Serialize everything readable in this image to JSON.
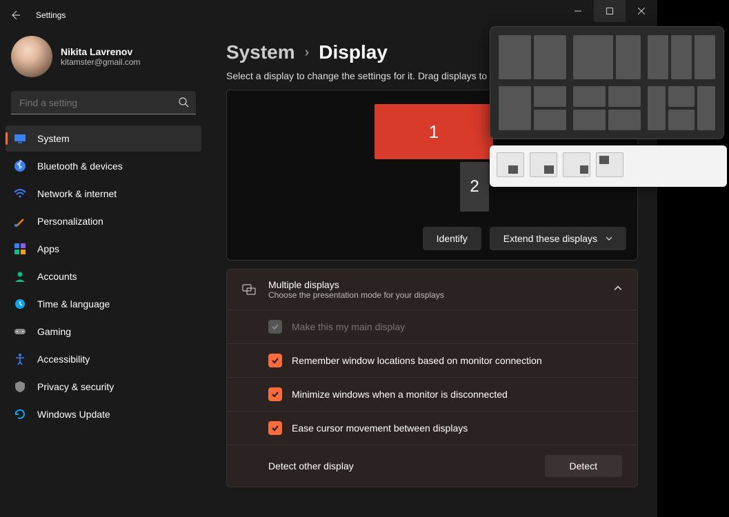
{
  "window": {
    "title": "Settings"
  },
  "profile": {
    "name": "Nikita Lavrenov",
    "email": "kitamster@gmail.com"
  },
  "search": {
    "placeholder": "Find a setting"
  },
  "nav": [
    {
      "id": "system",
      "label": "System",
      "active": true
    },
    {
      "id": "bluetooth",
      "label": "Bluetooth & devices"
    },
    {
      "id": "network",
      "label": "Network & internet"
    },
    {
      "id": "personalization",
      "label": "Personalization"
    },
    {
      "id": "apps",
      "label": "Apps"
    },
    {
      "id": "accounts",
      "label": "Accounts"
    },
    {
      "id": "time",
      "label": "Time & language"
    },
    {
      "id": "gaming",
      "label": "Gaming"
    },
    {
      "id": "accessibility",
      "label": "Accessibility"
    },
    {
      "id": "privacy",
      "label": "Privacy & security"
    },
    {
      "id": "update",
      "label": "Windows Update"
    }
  ],
  "breadcrumb": {
    "parent": "System",
    "current": "Display"
  },
  "subtitle": "Select a display to change the settings for it. Drag displays to rearrange them.",
  "displays": {
    "d1": "1",
    "d2": "2"
  },
  "arrange": {
    "identify": "Identify",
    "mode_selected": "Extend these displays"
  },
  "multi_panel": {
    "title": "Multiple displays",
    "subtitle": "Choose the presentation mode for your displays",
    "rows": {
      "main": "Make this my main display",
      "remember": "Remember window locations based on monitor connection",
      "minimize": "Minimize windows when a monitor is disconnected",
      "ease": "Ease cursor movement between displays",
      "detect_label": "Detect other display",
      "detect_btn": "Detect"
    }
  }
}
